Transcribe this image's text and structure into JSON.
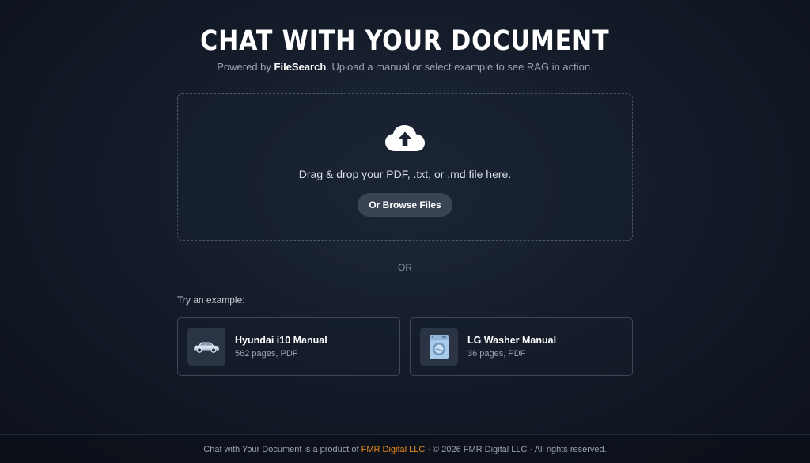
{
  "header": {
    "title": "CHAT WITH YOUR DOCUMENT",
    "subtitle_prefix": "Powered by ",
    "subtitle_brand": "FileSearch",
    "subtitle_suffix": ". Upload a manual or select example to see RAG in action."
  },
  "dropzone": {
    "icon": "cloud-upload-icon",
    "text": "Drag & drop your PDF, .txt, or .md file here.",
    "browse_label": "Or Browse Files"
  },
  "divider": {
    "text": "OR"
  },
  "examples": {
    "label": "Try an example:",
    "items": [
      {
        "title": "Hyundai i10 Manual",
        "meta": "562 pages, PDF",
        "icon": "car-icon"
      },
      {
        "title": "LG Washer Manual",
        "meta": "36 pages, PDF",
        "icon": "washing-machine-icon"
      }
    ]
  },
  "footer": {
    "prefix": "Chat with Your Document is a product of ",
    "brand_link": "FMR Digital LLC",
    "suffix": " · © 2026 FMR Digital LLC · All rights reserved."
  },
  "colors": {
    "accent_link": "#e8891e",
    "button_bg": "#3a4455",
    "background": "#141b29"
  }
}
